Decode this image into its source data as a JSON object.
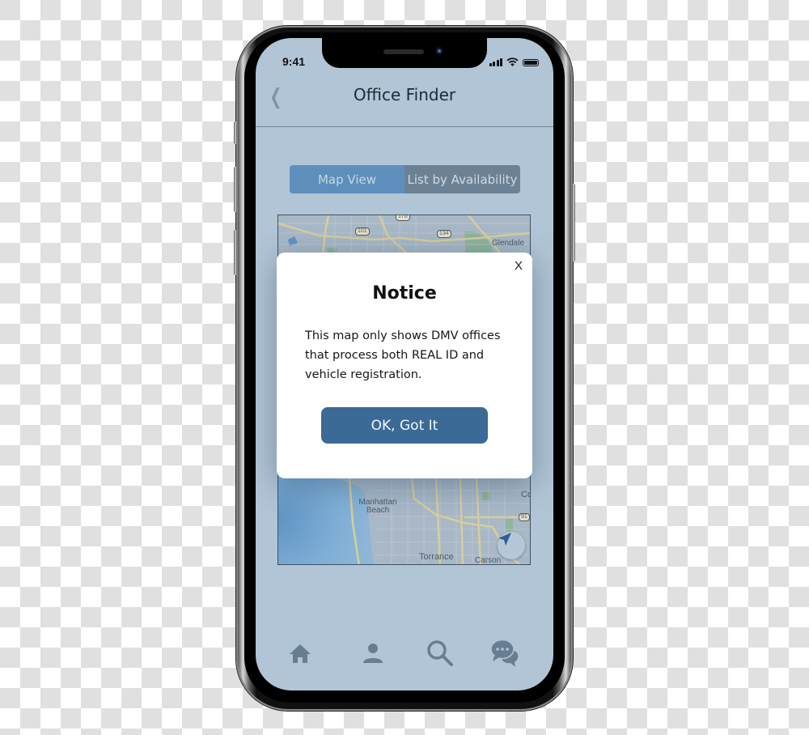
{
  "status_bar": {
    "time": "9:41",
    "icons": [
      "cellular-signal-icon",
      "wifi-icon",
      "battery-icon"
    ]
  },
  "nav": {
    "back_icon": "chevron-left-icon",
    "title": "Office Finder"
  },
  "segmented_control": {
    "options": [
      {
        "label": "Map View",
        "selected": true
      },
      {
        "label": "List by Availability",
        "selected": false
      }
    ]
  },
  "map": {
    "labels": {
      "glendale": "Glendale",
      "manhattan_beach": "Manhattan Beach",
      "torrance": "Torrance",
      "carson": "Carson",
      "compton_partial": "Co"
    },
    "route_shields": {
      "r170": "170",
      "r101": "101",
      "r134": "134",
      "r91": "91"
    },
    "locate_button_icon": "location-arrow-icon"
  },
  "modal": {
    "close_label": "X",
    "title": "Notice",
    "body": "This map only shows DMV offices that process both REAL ID and vehicle registration.",
    "button_label": "OK, Got It"
  },
  "tab_bar": {
    "items": [
      {
        "name": "home",
        "icon": "home-icon"
      },
      {
        "name": "profile",
        "icon": "person-icon"
      },
      {
        "name": "search",
        "icon": "search-icon"
      },
      {
        "name": "chat",
        "icon": "chat-bubbles-icon"
      }
    ]
  },
  "colors": {
    "screen_bg": "#b2c5d6",
    "segment_active": "#5e8fbc",
    "segment_inactive": "#6c8194",
    "primary_button": "#3c6a96",
    "icon_gray": "#677d91"
  }
}
